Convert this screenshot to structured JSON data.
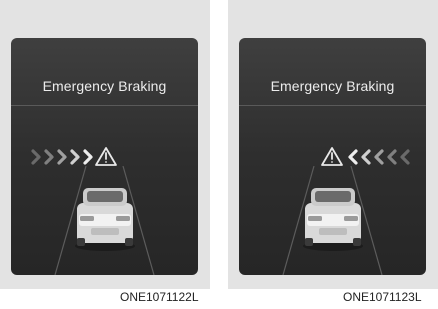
{
  "panels": [
    {
      "title": "Emergency Braking",
      "caption": "ONE1071122L",
      "arrow_direction": "right",
      "icon": "warning-icon"
    },
    {
      "title": "Emergency Braking",
      "caption": "ONE1071123L",
      "arrow_direction": "left",
      "icon": "warning-icon"
    }
  ],
  "colors": {
    "screen": "#333333",
    "text": "#ececec",
    "panel_bg": "#e3e3e3"
  }
}
